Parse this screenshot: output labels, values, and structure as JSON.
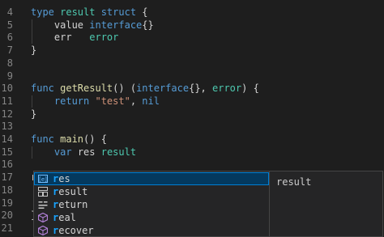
{
  "editor": {
    "lines": [
      {
        "num": "4",
        "tokens": [
          {
            "t": "type ",
            "c": "kw"
          },
          {
            "t": "result ",
            "c": "ty"
          },
          {
            "t": "struct",
            "c": "kw"
          },
          {
            "t": " {",
            "c": "pl"
          }
        ]
      },
      {
        "num": "5",
        "tokens": [
          {
            "t": "    value ",
            "c": "pl"
          },
          {
            "t": "interface",
            "c": "kw"
          },
          {
            "t": "{}",
            "c": "pl"
          }
        ]
      },
      {
        "num": "6",
        "tokens": [
          {
            "t": "    err   ",
            "c": "pl"
          },
          {
            "t": "error",
            "c": "ty"
          }
        ]
      },
      {
        "num": "7",
        "tokens": [
          {
            "t": "}",
            "c": "pl"
          }
        ]
      },
      {
        "num": "8",
        "tokens": []
      },
      {
        "num": "9",
        "tokens": []
      },
      {
        "num": "10",
        "tokens": [
          {
            "t": "func ",
            "c": "kw"
          },
          {
            "t": "getResult",
            "c": "fn"
          },
          {
            "t": "() (",
            "c": "pl"
          },
          {
            "t": "interface",
            "c": "kw"
          },
          {
            "t": "{}, ",
            "c": "pl"
          },
          {
            "t": "error",
            "c": "ty"
          },
          {
            "t": ") {",
            "c": "pl"
          }
        ]
      },
      {
        "num": "11",
        "tokens": [
          {
            "t": "    ",
            "c": "pl"
          },
          {
            "t": "return ",
            "c": "kw"
          },
          {
            "t": "\"test\"",
            "c": "str"
          },
          {
            "t": ", ",
            "c": "pl"
          },
          {
            "t": "nil",
            "c": "kw"
          }
        ]
      },
      {
        "num": "12",
        "tokens": [
          {
            "t": "}",
            "c": "pl"
          }
        ]
      },
      {
        "num": "13",
        "tokens": []
      },
      {
        "num": "14",
        "tokens": [
          {
            "t": "func ",
            "c": "kw"
          },
          {
            "t": "main",
            "c": "fn"
          },
          {
            "t": "() ",
            "c": "pl"
          },
          {
            "t": "{",
            "c": "pl"
          }
        ]
      },
      {
        "num": "15",
        "tokens": [
          {
            "t": "    ",
            "c": "pl"
          },
          {
            "t": "var ",
            "c": "kw"
          },
          {
            "t": "res ",
            "c": "pl"
          },
          {
            "t": "result",
            "c": "ty"
          }
        ]
      },
      {
        "num": "16",
        "tokens": []
      },
      {
        "num": "17",
        "tokens": [
          {
            "t": "r",
            "c": "pl"
          }
        ]
      },
      {
        "num": "18",
        "tokens": []
      },
      {
        "num": "19",
        "tokens": []
      },
      {
        "num": "20",
        "tokens": [
          {
            "t": "}",
            "c": "pl"
          }
        ]
      },
      {
        "num": "21",
        "tokens": []
      }
    ]
  },
  "suggest": {
    "items": [
      {
        "label": "res",
        "match": "r",
        "icon": "variable-icon",
        "selected": true
      },
      {
        "label": "result",
        "match": "r",
        "icon": "struct-icon",
        "selected": false
      },
      {
        "label": "return",
        "match": "r",
        "icon": "keyword-icon",
        "selected": false
      },
      {
        "label": "real",
        "match": "r",
        "icon": "function-icon",
        "selected": false
      },
      {
        "label": "recover",
        "match": "r",
        "icon": "function-icon",
        "selected": false
      }
    ],
    "detail": "result"
  },
  "colors": {
    "background": "#1e1e1e",
    "keyword": "#569cd6",
    "type": "#4ec9b0",
    "function": "#dcdcaa",
    "string": "#ce9178",
    "selection": "#04395e",
    "highlight": "#18a3ff"
  }
}
